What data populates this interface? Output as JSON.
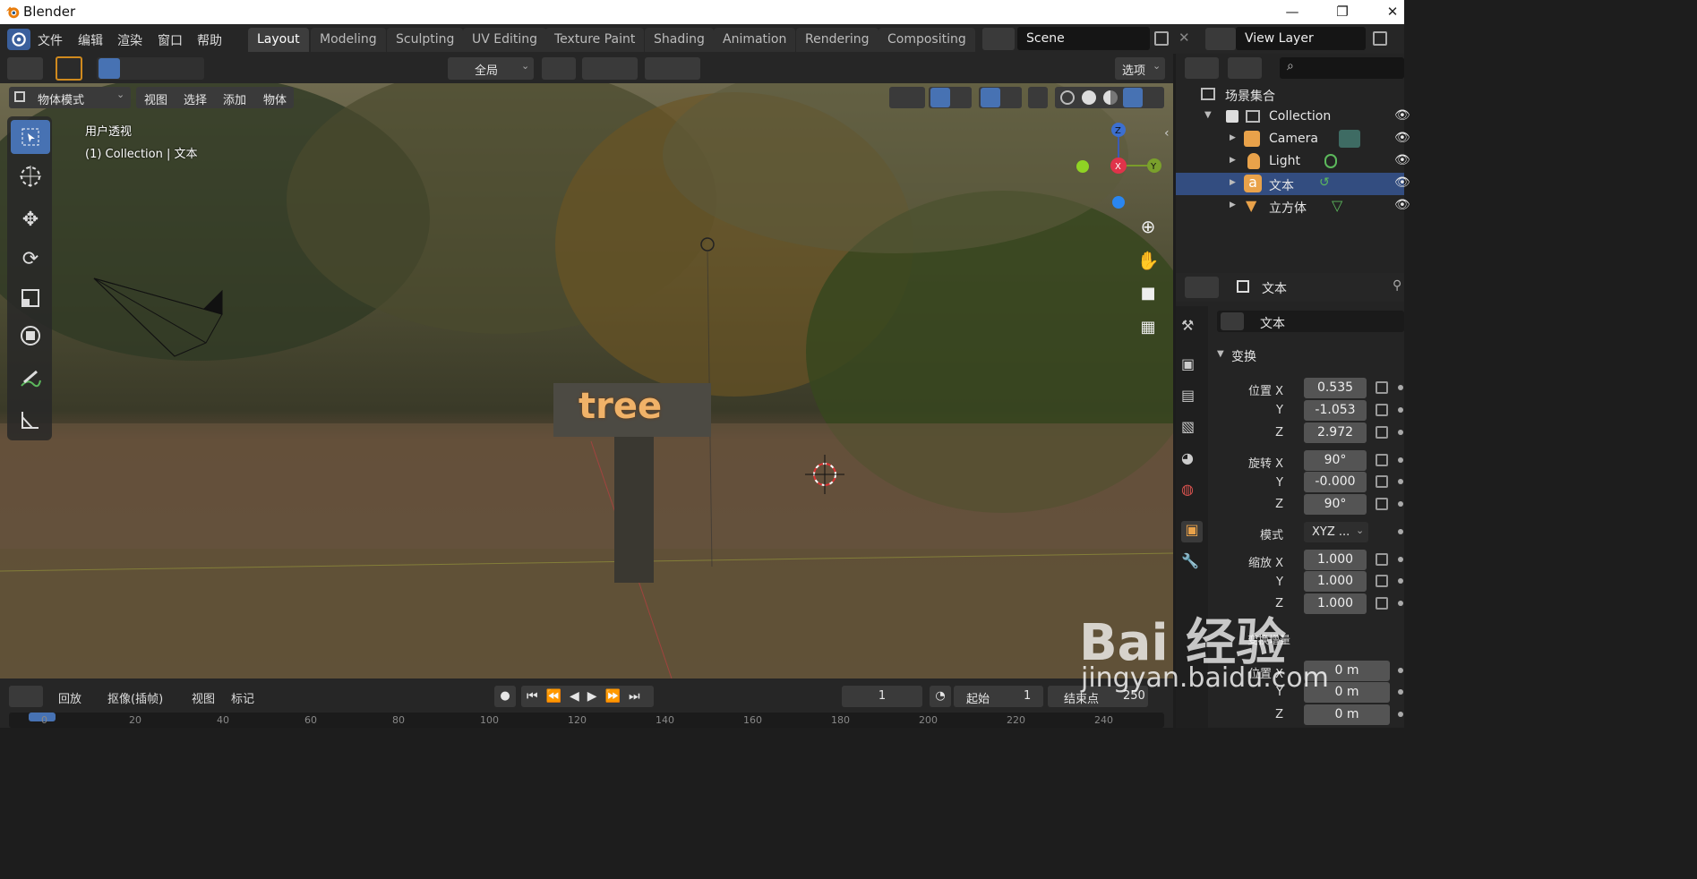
{
  "app": {
    "title": "Blender"
  },
  "menu": [
    "文件",
    "编辑",
    "渲染",
    "窗口",
    "帮助"
  ],
  "workspaces": [
    "Layout",
    "Modeling",
    "Sculpting",
    "UV Editing",
    "Texture Paint",
    "Shading",
    "Animation",
    "Rendering",
    "Compositing"
  ],
  "active_workspace": "Layout",
  "scene": {
    "name": "Scene"
  },
  "view_layer": {
    "name": "View Layer"
  },
  "viewport_header": {
    "transform_orientation": "全局",
    "options_label": "选项",
    "mode": "物体模式",
    "menus": [
      "视图",
      "选择",
      "添加",
      "物体"
    ]
  },
  "viewport": {
    "view_name": "用户透视",
    "collection_info": "(1) Collection | 文本",
    "sign_text": "tree"
  },
  "timeline": {
    "playback": "回放",
    "keying": "抠像(插帧)",
    "view": "视图",
    "marker": "标记",
    "current_frame": "1",
    "start_label": "起始",
    "start_value": "1",
    "end_label": "结束点",
    "end_value": "250",
    "ruler": [
      "0",
      "20",
      "40",
      "60",
      "80",
      "100",
      "120",
      "140",
      "160",
      "180",
      "200",
      "220",
      "240"
    ]
  },
  "outliner": {
    "root": "场景集合",
    "collection": "Collection",
    "items": [
      {
        "name": "Camera",
        "icon": "camera-icon",
        "color": "#e9a24a"
      },
      {
        "name": "Light",
        "icon": "light-icon",
        "color": "#e9a24a"
      },
      {
        "name": "文本",
        "icon": "text-object-icon",
        "color": "#e9a24a",
        "selected": true
      },
      {
        "name": "立方体",
        "icon": "mesh-object-icon",
        "color": "#e9a24a"
      }
    ]
  },
  "properties": {
    "object_name": "文本",
    "data_name": "文本",
    "transform_title": "变换",
    "location_label": "位置 X",
    "location": [
      "0.535",
      "-1.053",
      "2.972"
    ],
    "rotation_label": "旋转 X",
    "rotation": [
      "90°",
      "-0.000",
      "90°"
    ],
    "mode_label": "模式",
    "mode_value": "XYZ ...",
    "scale_label": "缩放 X",
    "scale": [
      "1.000",
      "1.000",
      "1.000"
    ],
    "axis_y": "Y",
    "axis_z": "Z",
    "delta_title": "变换增量",
    "delta_location_label": "位置 X",
    "delta_location": [
      "0 m",
      "0 m",
      "0 m"
    ]
  },
  "watermark": {
    "brand": "Bai 经验",
    "url": "jingyan.baidu.com"
  },
  "colors": {
    "accent": "#4772b3",
    "selection": "#334d80",
    "orange": "#e9a24a",
    "green": "#5cb85c"
  }
}
